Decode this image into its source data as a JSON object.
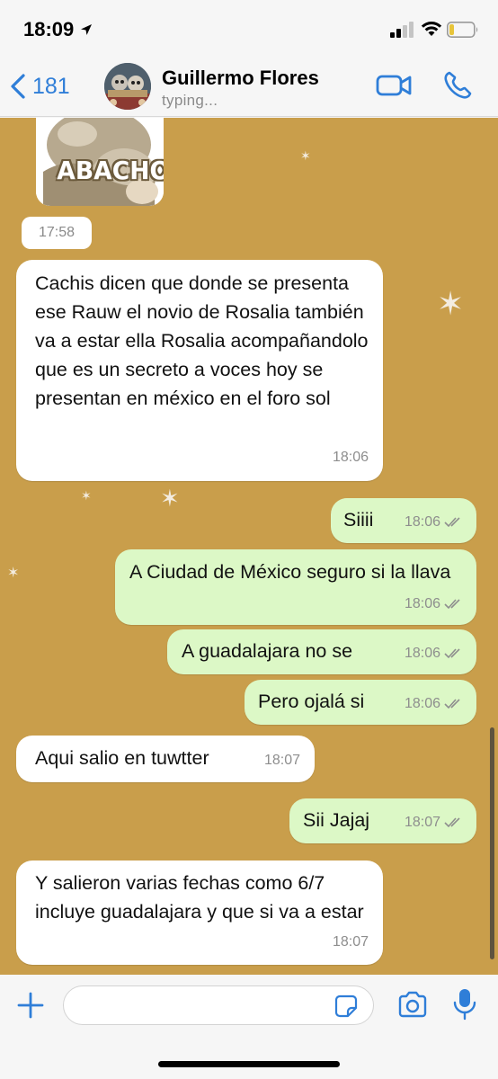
{
  "status_bar": {
    "time": "18:09"
  },
  "header": {
    "back_count": "181",
    "contact_name": "Guillermo Flores",
    "contact_status": "typing..."
  },
  "chat": {
    "sticker_text": "ABACHO",
    "sticker_time": "17:58",
    "messages": [
      {
        "direction": "in",
        "text": "Cachis dicen que donde se presenta ese Rauw el novio de Rosalia también va a estar ella Rosalia acompañandolo que es un secreto a voces hoy se presentan en méxico en el foro sol",
        "time": "18:06"
      },
      {
        "direction": "out",
        "text": "Siiii",
        "time": "18:06",
        "status": "read"
      },
      {
        "direction": "out",
        "text": "A Ciudad de México seguro si la llava",
        "time": "18:06",
        "status": "read"
      },
      {
        "direction": "out",
        "text": "A guadalajara no se",
        "time": "18:06",
        "status": "read"
      },
      {
        "direction": "out",
        "text": "Pero ojalá si",
        "time": "18:06",
        "status": "read"
      },
      {
        "direction": "in",
        "text": "Aqui salio en tuwtter",
        "time": "18:07"
      },
      {
        "direction": "out",
        "text": "Sii Jajaj",
        "time": "18:07",
        "status": "read"
      },
      {
        "direction": "in",
        "text": "Y salieron varias fechas como 6/7 incluye guadalajara y que si va a estar",
        "time": "18:07"
      }
    ]
  },
  "input_bar": {
    "placeholder": ""
  },
  "colors": {
    "accent": "#2f7ed8",
    "chat_background": "#c99e4b",
    "incoming_bubble": "#ffffff",
    "outgoing_bubble": "#dcf8c6",
    "read_ticks": "#8e8e8e"
  }
}
